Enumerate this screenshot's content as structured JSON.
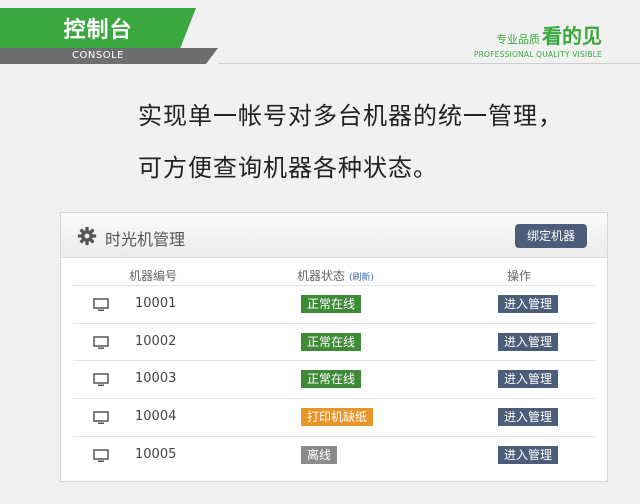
{
  "banner": {
    "title": "控制台",
    "subtitle": "CONSOLE",
    "slogan_small": "专业品质",
    "slogan_big": "看的见",
    "slogan_en": "PROFESSIONAL QUALITY VISIBLE",
    "colors": {
      "brand_green": "#3aa83f",
      "strip_gray": "#6e6e6e"
    }
  },
  "headline": {
    "line1": "实现单一帐号对多台机器的统一管理，",
    "line2": "可方便查询机器各种状态。"
  },
  "panel": {
    "title": "时光机管理",
    "title_icon": "gear-icon",
    "bind_button": "绑定机器",
    "columns": {
      "id": "机器编号",
      "status": "机器状态",
      "refresh": "(刷新)",
      "action": "操作"
    },
    "rows": [
      {
        "icon": "monitor-icon",
        "id": "10001",
        "status": "正常在线",
        "status_type": "ok",
        "action": "进入管理"
      },
      {
        "icon": "monitor-icon",
        "id": "10002",
        "status": "正常在线",
        "status_type": "ok",
        "action": "进入管理"
      },
      {
        "icon": "monitor-icon",
        "id": "10003",
        "status": "正常在线",
        "status_type": "ok",
        "action": "进入管理"
      },
      {
        "icon": "monitor-icon",
        "id": "10004",
        "status": "打印机缺纸",
        "status_type": "warn",
        "action": "进入管理"
      },
      {
        "icon": "monitor-icon",
        "id": "10005",
        "status": "离线",
        "status_type": "off",
        "action": "进入管理"
      }
    ],
    "status_colors": {
      "ok": "#3f8a37",
      "warn": "#e8962a",
      "off": "#8a8a8a",
      "button": "#4b5d78"
    }
  }
}
